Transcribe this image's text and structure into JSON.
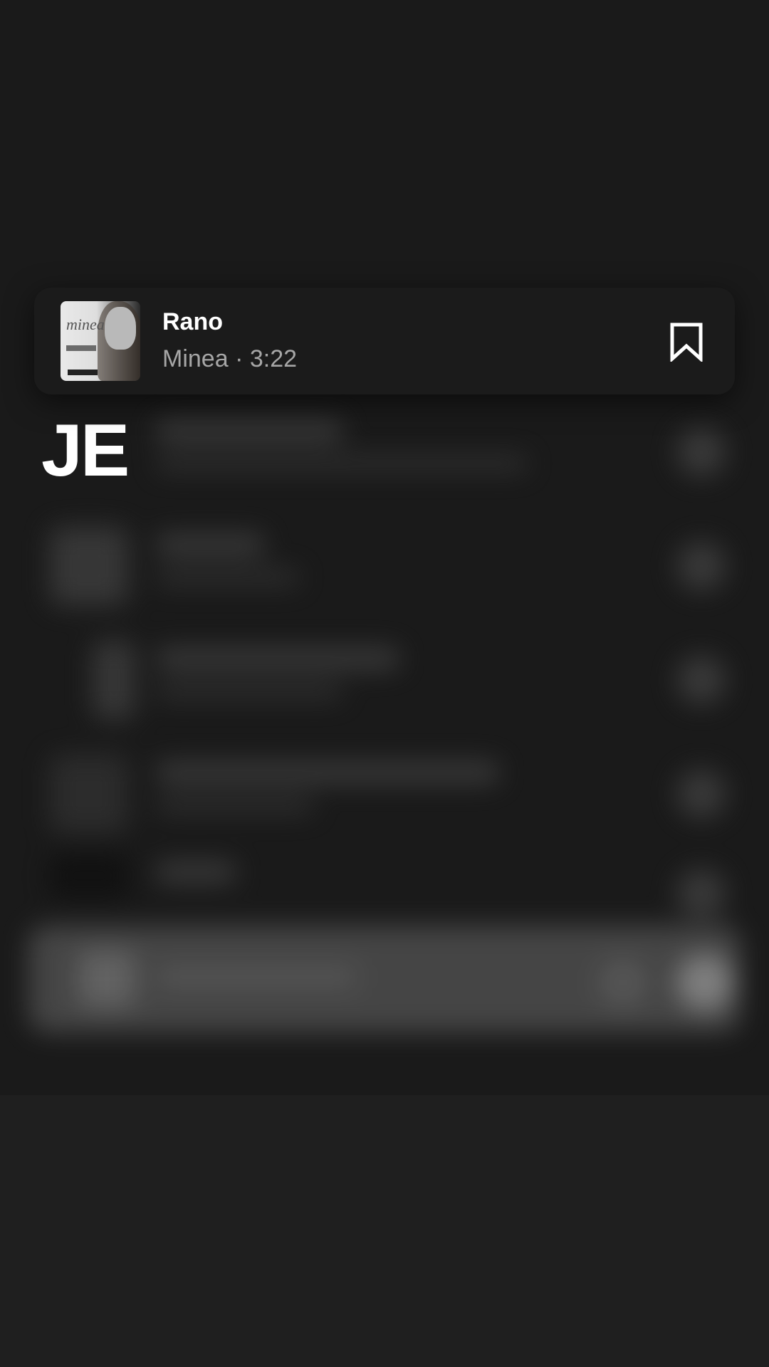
{
  "section": {
    "letter": "JE"
  },
  "track": {
    "title": "Rano",
    "artist": "Minea",
    "separator": "·",
    "duration": "3:22",
    "cover_logo": "minea"
  },
  "icons": {
    "bookmark": "bookmark-outline-icon"
  },
  "colors": {
    "background": "#1a1a1a",
    "card": "#1b1b1b",
    "title": "#ffffff",
    "meta": "#a6a6a6"
  }
}
